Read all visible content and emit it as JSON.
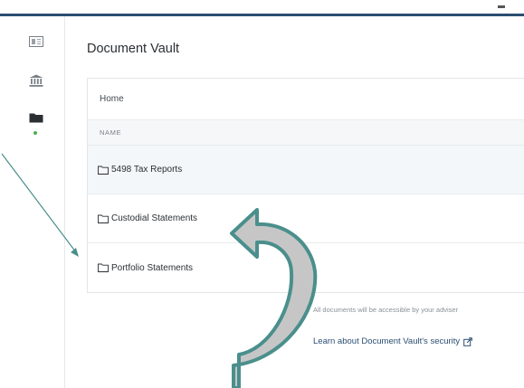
{
  "page": {
    "title": "Document Vault"
  },
  "sidebar": {
    "items": [
      {
        "name": "news-icon"
      },
      {
        "name": "bank-icon"
      },
      {
        "name": "folder-icon",
        "active": true
      }
    ],
    "active_indicator_color": "#4caf50"
  },
  "vault": {
    "breadcrumb": "Home",
    "column_header": "NAME",
    "rows": [
      {
        "label": "5498 Tax Reports"
      },
      {
        "label": "Custodial Statements"
      },
      {
        "label": "Portfolio Statements"
      }
    ]
  },
  "footer": {
    "adviser_note": "All documents will be accessible by your adviser",
    "security_link": "Learn about Document Vault's security"
  },
  "colors": {
    "accent": "#2b4e72",
    "arrow": "#4a8f8c"
  }
}
